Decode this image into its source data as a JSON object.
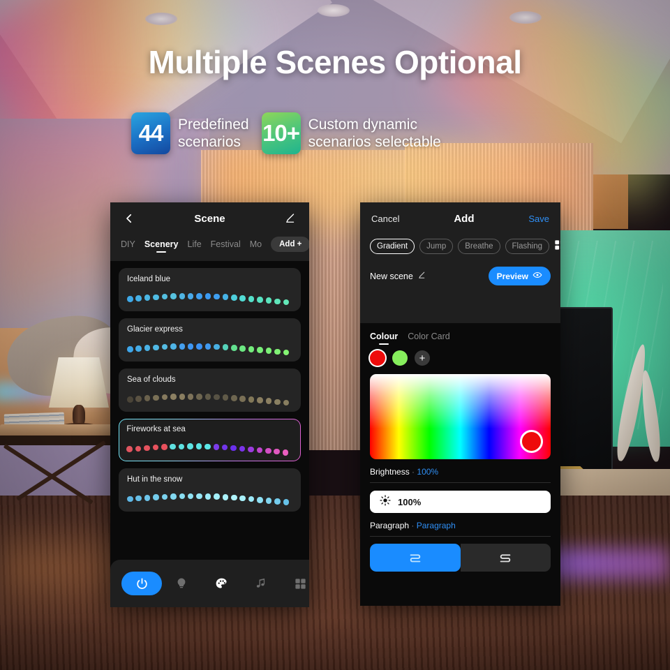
{
  "headline": "Multiple Scenes Optional",
  "stats": [
    {
      "badge": "44",
      "text": "Predefined\nscenarios",
      "color": "#1b6fc4"
    },
    {
      "badge": "10+",
      "text": "Custom dynamic\nscenarios selectable",
      "color": "#49c47d"
    }
  ],
  "left_phone": {
    "back_icon": "chevron-left-icon",
    "title": "Scene",
    "edit_icon": "pencil-icon",
    "tabs": [
      {
        "label": "DIY",
        "active": false
      },
      {
        "label": "Scenery",
        "active": true
      },
      {
        "label": "Life",
        "active": false
      },
      {
        "label": "Festival",
        "active": false
      },
      {
        "label": "Mo",
        "active": false
      }
    ],
    "add_button": "Add +",
    "scenes": [
      {
        "name": "Iceland blue",
        "selected": false,
        "colors": [
          "#3fa9e8",
          "#45b0e6",
          "#4ab6e4",
          "#4fbbe2",
          "#54bfe0",
          "#57c2df",
          "#4fb4e3",
          "#49a9e9",
          "#3f9ff0",
          "#3b9af2",
          "#3f9ff0",
          "#46b3e6",
          "#4ecfdc",
          "#52dcd4",
          "#55e0c9",
          "#58e2c2",
          "#5ce4bd",
          "#60e6ba",
          "#63e8b8"
        ]
      },
      {
        "name": "Glacier express",
        "selected": false,
        "colors": [
          "#3ea6ea",
          "#44ace8",
          "#4ab2e6",
          "#50b8e4",
          "#55bce2",
          "#4fb4e6",
          "#459fee",
          "#3e96f2",
          "#3b92f4",
          "#4099ef",
          "#48b0e3",
          "#55d2b9",
          "#62e08f",
          "#6ce882",
          "#74ec7c",
          "#78ee79",
          "#7cf077",
          "#80f275",
          "#84f473"
        ]
      },
      {
        "name": "Sea of clouds",
        "selected": false,
        "colors": [
          "#4a4438",
          "#5a5242",
          "#6a614c",
          "#7a7056",
          "#867a5e",
          "#8c8062",
          "#8a7e60",
          "#7e735a",
          "#6e6650",
          "#605a48",
          "#575244",
          "#605a48",
          "#6e6650",
          "#7a7056",
          "#827858",
          "#8a7e60",
          "#8c8062",
          "#8a8062",
          "#887e60"
        ]
      },
      {
        "name": "Fireworks at sea",
        "selected": true,
        "colors": [
          "#e05560",
          "#e2545f",
          "#e4535e",
          "#e6525d",
          "#e8515c",
          "#5fe0e0",
          "#5ee2e2",
          "#5de4e4",
          "#5ce6e6",
          "#5be8e8",
          "#7b3ce8",
          "#7135ea",
          "#6a30ec",
          "#7b33ea",
          "#9b3bdd",
          "#c046cf",
          "#d34fc6",
          "#e058c0",
          "#e95fc0"
        ]
      },
      {
        "name": "Hut in the snow",
        "selected": false,
        "colors": [
          "#5fb8e6",
          "#66bfe8",
          "#6dc5ea",
          "#74ccec",
          "#7bd2ee",
          "#82d8f0",
          "#89def2",
          "#8fe2f4",
          "#96e6f6",
          "#9debf8",
          "#a4effa",
          "#abf2fb",
          "#b0f4fc",
          "#a8f0fa",
          "#9ce9f8",
          "#8fe0f4",
          "#82d6f0",
          "#74ccec",
          "#66c2e8"
        ]
      }
    ],
    "bottom_bar": [
      {
        "icon": "power-icon",
        "active": true
      },
      {
        "icon": "bulb-icon",
        "active": false
      },
      {
        "icon": "palette-icon",
        "active": false
      },
      {
        "icon": "music-icon",
        "active": false
      },
      {
        "icon": "grid-icon",
        "active": false
      }
    ]
  },
  "right_phone": {
    "cancel": "Cancel",
    "title": "Add",
    "save": "Save",
    "modes": [
      {
        "label": "Gradient",
        "active": true
      },
      {
        "label": "Jump",
        "active": false
      },
      {
        "label": "Breathe",
        "active": false
      },
      {
        "label": "Flashing",
        "active": false
      }
    ],
    "grid_icon": "grid-icon",
    "scene_name": "New scene",
    "scene_edit_icon": "pencil-icon",
    "preview_label": "Preview",
    "preview_icon": "eye-icon",
    "preview_colors": [
      "#c8c0d8",
      "#d0c4dc",
      "#d6c6dd",
      "#dcc8de",
      "#e2c8dd",
      "#e8c4da",
      "#ecbfd6",
      "#eebbd3",
      "#eeb4d0",
      "#eaa9cd",
      "#e49ed2",
      "#dd93da",
      "#d688e2",
      "#cf7fe6",
      "#c87ae8",
      "#bd7ae8",
      "#b47ce6",
      "#ab80e4",
      "#a685e2"
    ],
    "colour_tab": "Colour",
    "colorcard_tab": "Color Card",
    "swatches": [
      {
        "color": "#ee0b0b",
        "selected": true
      },
      {
        "color": "#86ee5c",
        "selected": false
      }
    ],
    "add_swatch": "+",
    "picker_color": "#ee0b0b",
    "brightness_label": "Brightness",
    "brightness_sep": "·",
    "brightness_value": "100%",
    "brightness_slider_icon": "sun-icon",
    "brightness_slider_value": "100%",
    "paragraph_label": "Paragraph",
    "paragraph_sep": "·",
    "paragraph_value": "Paragraph",
    "direction_buttons": [
      {
        "icon": "flow-right-icon",
        "active": true
      },
      {
        "icon": "flow-left-icon",
        "active": false
      }
    ]
  }
}
